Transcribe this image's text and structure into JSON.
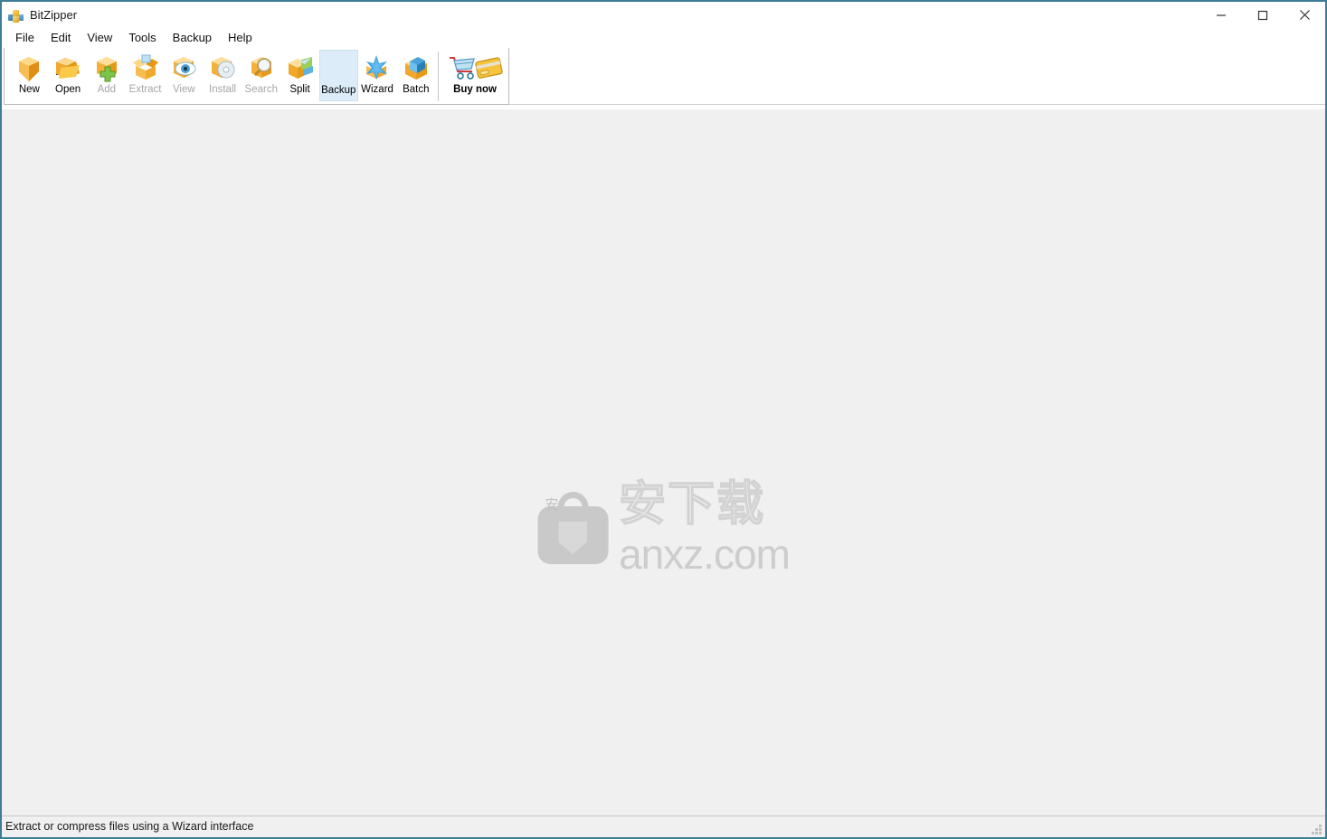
{
  "window": {
    "title": "BitZipper",
    "app_icon": "app-blocks-icon",
    "controls": [
      {
        "name": "minimize-button",
        "icon": "minimize-icon"
      },
      {
        "name": "maximize-button",
        "icon": "maximize-icon"
      },
      {
        "name": "close-button",
        "icon": "close-icon"
      }
    ]
  },
  "menubar": {
    "items": [
      {
        "label": "File"
      },
      {
        "label": "Edit"
      },
      {
        "label": "View"
      },
      {
        "label": "Tools"
      },
      {
        "label": "Backup"
      },
      {
        "label": "Help"
      }
    ]
  },
  "toolbar": {
    "buttons": [
      {
        "label": "New",
        "icon": "new-archive-icon",
        "enabled": true,
        "hover": false
      },
      {
        "label": "Open",
        "icon": "open-folder-icon",
        "enabled": true,
        "hover": false
      },
      {
        "label": "Add",
        "icon": "add-files-icon",
        "enabled": false,
        "hover": false
      },
      {
        "label": "Extract",
        "icon": "extract-box-icon",
        "enabled": false,
        "hover": false
      },
      {
        "label": "View",
        "icon": "view-eye-icon",
        "enabled": false,
        "hover": false
      },
      {
        "label": "Install",
        "icon": "install-disc-icon",
        "enabled": false,
        "hover": false
      },
      {
        "label": "Search",
        "icon": "search-magnifier-icon",
        "enabled": false,
        "hover": false
      },
      {
        "label": "Split",
        "icon": "split-archive-icon",
        "enabled": true,
        "hover": false
      },
      {
        "label": "Backup",
        "icon": "backup-icon",
        "enabled": true,
        "hover": true
      },
      {
        "label": "Wizard",
        "icon": "wizard-star-icon",
        "enabled": true,
        "hover": false
      },
      {
        "label": "Batch",
        "icon": "batch-box-icon",
        "enabled": true,
        "hover": false
      }
    ],
    "buy_now": {
      "label": "Buy now",
      "icon": "cart-card-icon"
    }
  },
  "client": {
    "watermark": {
      "chinese": "安下载",
      "domain": "anxz.com",
      "badge_char": "安",
      "icon": "bag-shield-icon"
    }
  },
  "statusbar": {
    "message": "Extract or compress files using a Wizard interface",
    "grip": "resize-grip-icon"
  },
  "colors": {
    "window_border": "#3d7d96",
    "client_bg": "#f0f0f0",
    "hover_bg": "#dcedf9",
    "disabled_text": "#a6a6a6",
    "watermark_gray": "#cdcdcd"
  }
}
